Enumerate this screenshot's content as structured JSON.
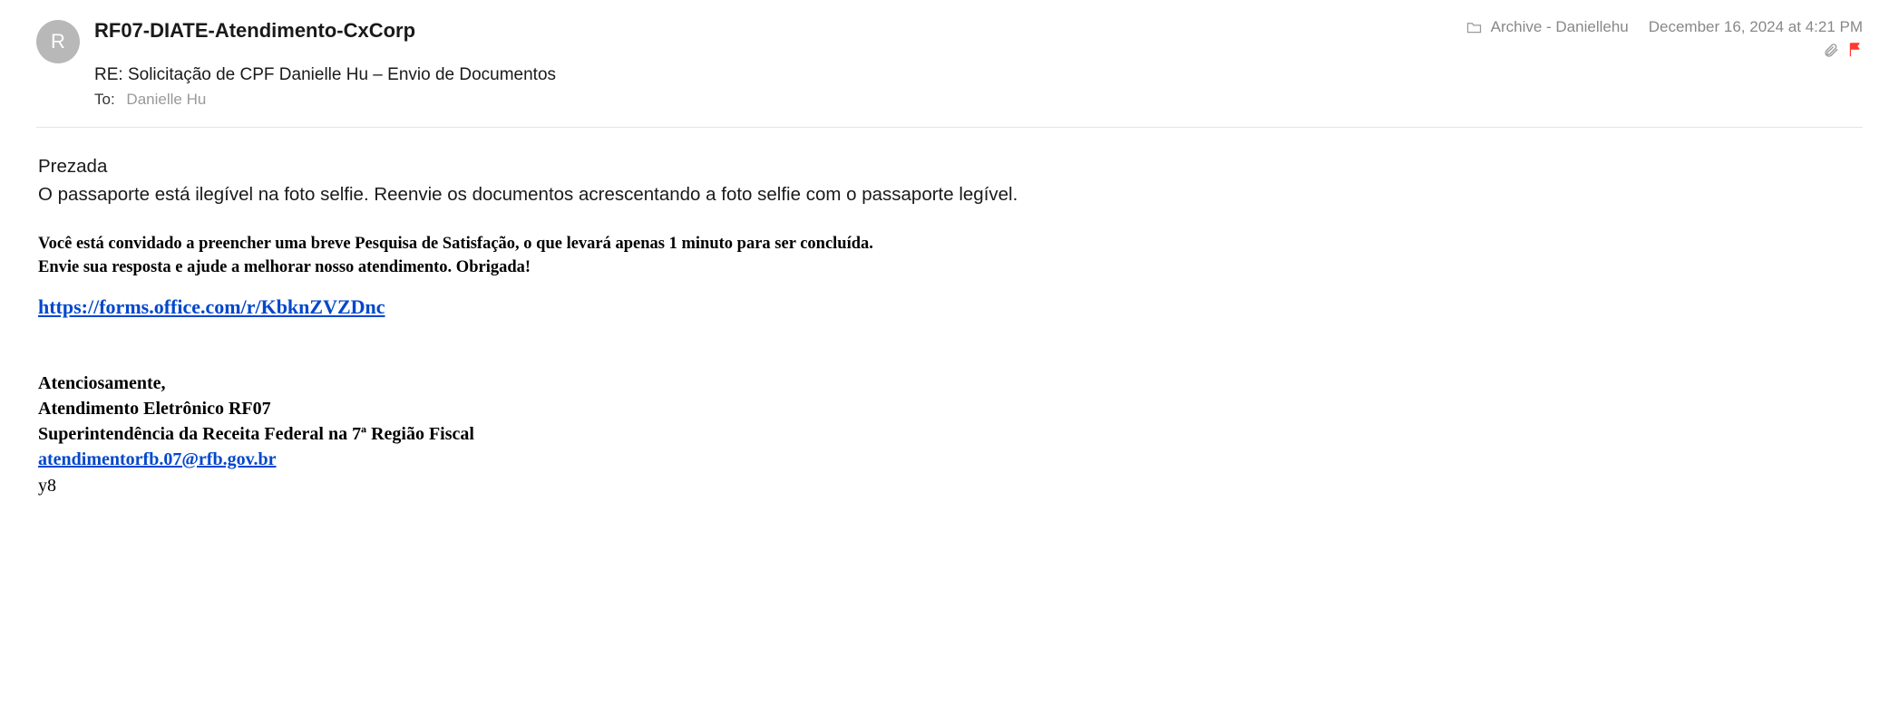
{
  "header": {
    "avatarInitial": "R",
    "senderName": "RF07-DIATE-Atendimento-CxCorp",
    "folderLabel": "Archive - Daniellehu",
    "timestamp": "December 16, 2024 at 4:21 PM",
    "subject": "RE: Solicitação de CPF Danielle Hu – Envio de Documentos",
    "toLabel": "To:",
    "toValue": "Danielle Hu"
  },
  "body": {
    "greeting": "Prezada",
    "mainMessage": "O passaporte está ilegível na foto selfie. Reenvie os documentos acrescentando a foto selfie com o passaporte legível.",
    "surveyLine1": "Você está convidado a preencher uma breve Pesquisa de Satisfação, o que levará apenas 1 minuto para ser concluída.",
    "surveyLine2": "Envie sua resposta e ajude a melhorar nosso atendimento. Obrigada!",
    "surveyLink": "https://forms.office.com/r/KbknZVZDnc",
    "sigLine1": "Atenciosamente,",
    "sigLine2": "Atendimento Eletrônico RF07",
    "sigLine3": "Superintendência da Receita Federal na 7ª Região Fiscal",
    "sigEmail": "atendimentorfb.07@rfb.gov.br",
    "trailing": "y8"
  }
}
